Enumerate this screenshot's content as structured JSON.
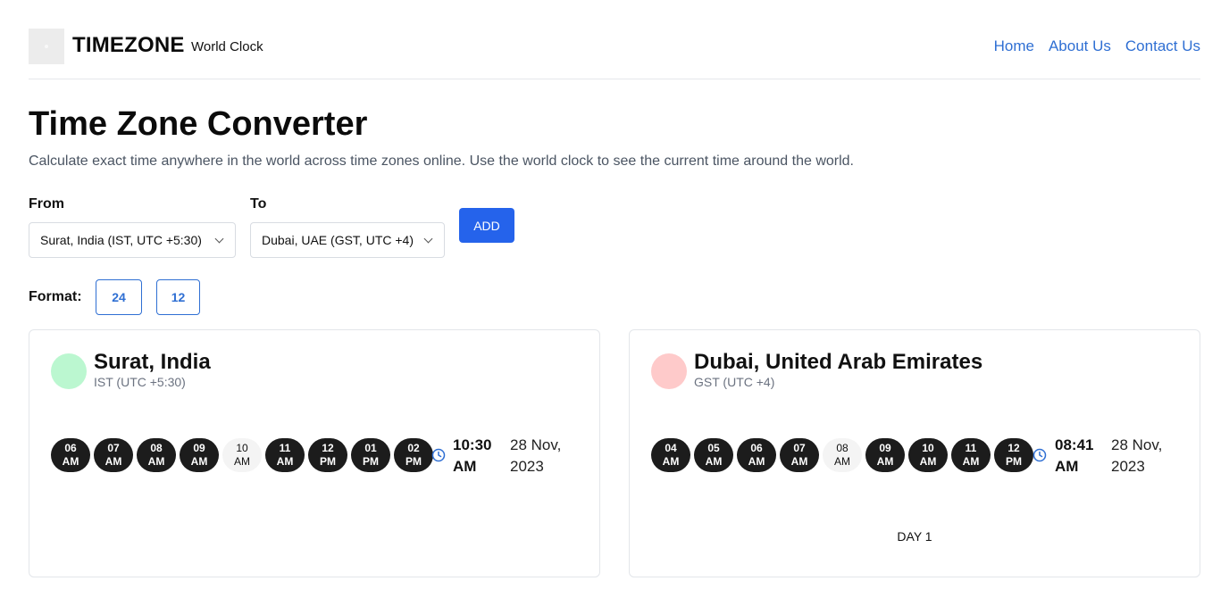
{
  "header": {
    "brand": "TIMEZONE",
    "brand_sub": "World Clock",
    "nav": [
      "Home",
      "About Us",
      "Contact Us"
    ]
  },
  "main": {
    "title": "Time Zone Converter",
    "description": "Calculate exact time anywhere in the world across time zones online. Use the world clock to see the current time around the world."
  },
  "form": {
    "from_label": "From",
    "from_value": "Surat, India (IST, UTC +5:30)",
    "to_label": "To",
    "to_value": "Dubai, UAE (GST, UTC +4)",
    "add_label": "ADD",
    "format_label": "Format:",
    "format_options": [
      "24",
      "12"
    ]
  },
  "cards": [
    {
      "city": "Surat, India",
      "timezone": "IST (UTC +5:30)",
      "avatar_color": "#bbf7d0",
      "hours": [
        {
          "h": "06",
          "p": "AM"
        },
        {
          "h": "07",
          "p": "AM"
        },
        {
          "h": "08",
          "p": "AM"
        },
        {
          "h": "09",
          "p": "AM"
        },
        {
          "h": "10",
          "p": "AM"
        },
        {
          "h": "11",
          "p": "AM"
        },
        {
          "h": "12",
          "p": "PM"
        },
        {
          "h": "01",
          "p": "PM"
        },
        {
          "h": "02",
          "p": "PM"
        }
      ],
      "current_hour_index": 4,
      "time_main": "10:30",
      "time_period": "AM",
      "date_day": "28 Nov,",
      "date_year": "2023",
      "day_label": ""
    },
    {
      "city": "Dubai, United Arab Emirates",
      "timezone": "GST (UTC +4)",
      "avatar_color": "#fecaca",
      "hours": [
        {
          "h": "04",
          "p": "AM"
        },
        {
          "h": "05",
          "p": "AM"
        },
        {
          "h": "06",
          "p": "AM"
        },
        {
          "h": "07",
          "p": "AM"
        },
        {
          "h": "08",
          "p": "AM"
        },
        {
          "h": "09",
          "p": "AM"
        },
        {
          "h": "10",
          "p": "AM"
        },
        {
          "h": "11",
          "p": "AM"
        },
        {
          "h": "12",
          "p": "PM"
        }
      ],
      "current_hour_index": 4,
      "time_main": "08:41",
      "time_period": "AM",
      "date_day": "28 Nov,",
      "date_year": "2023",
      "day_label": "DAY 1"
    }
  ],
  "colors": {
    "accent": "#2563eb",
    "link": "#2f6fd3",
    "hour_pill": "#1c1c1c",
    "current_hour_pill": "#f4f4f4"
  }
}
